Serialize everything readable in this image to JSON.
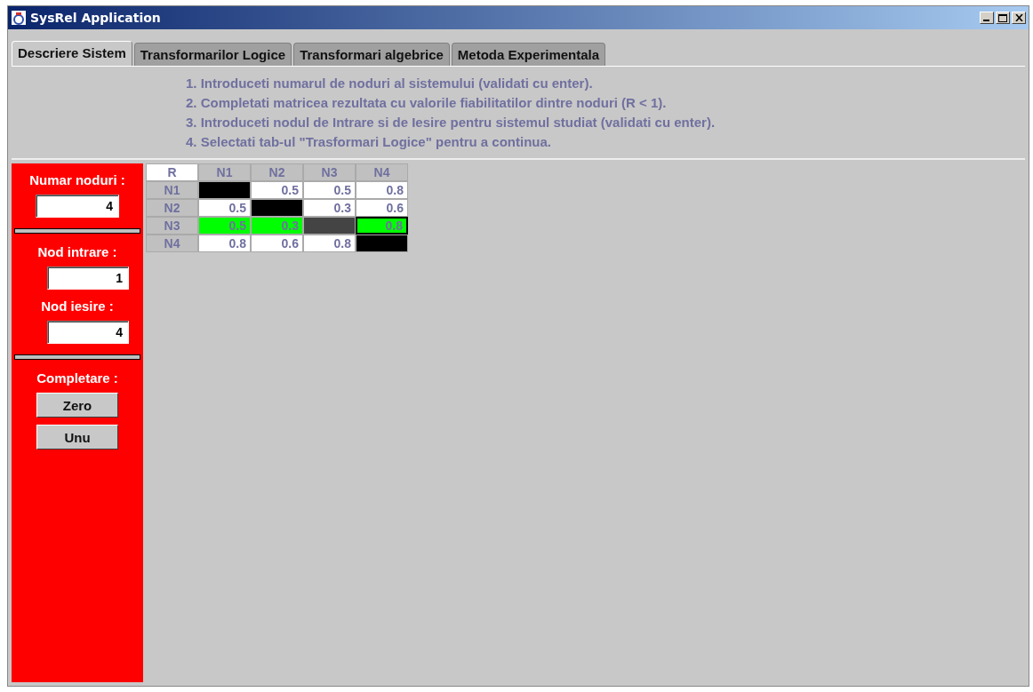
{
  "window": {
    "title": "SysRel Application"
  },
  "tabs": [
    {
      "label": "Descriere Sistem",
      "selected": true
    },
    {
      "label": "Transformarilor Logice",
      "selected": false
    },
    {
      "label": "Transformari algebrice",
      "selected": false
    },
    {
      "label": "Metoda Experimentala",
      "selected": false
    }
  ],
  "instructions": [
    "1. Introduceti numarul de noduri al sistemului (validati cu enter).",
    "2. Completati matricea rezultata cu valorile fiabilitatilor dintre noduri (R < 1).",
    "3. Introduceti nodul de Intrare si de Iesire pentru sistemul studiat (validati cu enter).",
    "4. Selectati tab-ul \"Trasformari Logice\" pentru a continua."
  ],
  "side_panel": {
    "node_count_label": "Numar noduri :",
    "node_count": "4",
    "entry_label": "Nod intrare :",
    "entry_value": "1",
    "exit_label": "Nod iesire :",
    "exit_value": "4",
    "fill_label": "Completare :",
    "buttons": [
      "Zero",
      "Unu"
    ]
  },
  "matrix": {
    "corner": "R",
    "columns": [
      "N1",
      "N2",
      "N3",
      "N4"
    ],
    "rows": [
      {
        "label": "N1",
        "selected": false,
        "cells": [
          {
            "kind": "diagonal",
            "focused": false
          },
          {
            "kind": "value",
            "value": "0.5",
            "focused": false
          },
          {
            "kind": "value",
            "value": "0.5",
            "focused": false
          },
          {
            "kind": "value",
            "value": "0.8",
            "focused": false
          }
        ]
      },
      {
        "label": "N2",
        "selected": false,
        "cells": [
          {
            "kind": "value",
            "value": "0.5",
            "focused": false
          },
          {
            "kind": "diagonal",
            "focused": false
          },
          {
            "kind": "value",
            "value": "0.3",
            "focused": false
          },
          {
            "kind": "value",
            "value": "0.6",
            "focused": false
          }
        ]
      },
      {
        "label": "N3",
        "selected": true,
        "cells": [
          {
            "kind": "value",
            "value": "0.5",
            "focused": false
          },
          {
            "kind": "value",
            "value": "0.3",
            "focused": false
          },
          {
            "kind": "diagonal",
            "focused": false
          },
          {
            "kind": "value",
            "value": "0.8",
            "focused": true
          }
        ]
      },
      {
        "label": "N4",
        "selected": false,
        "cells": [
          {
            "kind": "value",
            "value": "0.8",
            "focused": false
          },
          {
            "kind": "value",
            "value": "0.6",
            "focused": false
          },
          {
            "kind": "value",
            "value": "0.8",
            "focused": false
          },
          {
            "kind": "diagonal",
            "focused": false
          }
        ]
      }
    ]
  }
}
